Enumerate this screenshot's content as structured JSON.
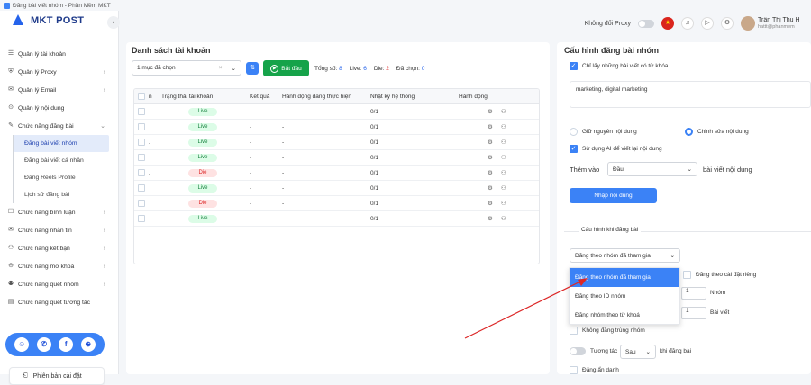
{
  "window": {
    "title": "Đăng bài viết nhóm - Phần Mềm MKT"
  },
  "sidebar": {
    "logo": "MKT POST",
    "collapse_glyph": "‹",
    "items": [
      {
        "label": "Quản lý tài khoản",
        "icon": "list-icon",
        "glyph": "☰",
        "chevron": ""
      },
      {
        "label": "Quản lý Proxy",
        "icon": "shield-icon",
        "glyph": "⛨",
        "chevron": "›"
      },
      {
        "label": "Quản lý Email",
        "icon": "mail-icon",
        "glyph": "✉",
        "chevron": "›"
      },
      {
        "label": "Quản lý nội dung",
        "icon": "content-icon",
        "glyph": "⊙",
        "chevron": ""
      },
      {
        "label": "Chức năng đăng bài",
        "icon": "post-icon",
        "glyph": "✎",
        "chevron": "⌄"
      }
    ],
    "sub_items": [
      {
        "label": "Đăng bài viết nhóm",
        "active": true
      },
      {
        "label": "Đăng bài viết cá nhân",
        "active": false
      },
      {
        "label": "Đăng Reels Profile",
        "active": false
      },
      {
        "label": "Lịch sử đăng bài",
        "active": false
      }
    ],
    "items_after": [
      {
        "label": "Chức năng bình luận",
        "icon": "comment-icon",
        "glyph": "☐",
        "chevron": "›"
      },
      {
        "label": "Chức năng nhắn tin",
        "icon": "message-icon",
        "glyph": "✉",
        "chevron": "›"
      },
      {
        "label": "Chức năng kết bạn",
        "icon": "add-friend-icon",
        "glyph": "⚇",
        "chevron": "›"
      },
      {
        "label": "Chức năng mở khoá",
        "icon": "unlock-icon",
        "glyph": "⊖",
        "chevron": "›"
      },
      {
        "label": "Chức năng quét nhóm",
        "icon": "group-icon",
        "glyph": "⚉",
        "chevron": "›"
      },
      {
        "label": "Chức năng quét tương tác",
        "icon": "interaction-icon",
        "glyph": "▤",
        "chevron": ""
      }
    ],
    "social": [
      {
        "name": "support-icon",
        "glyph": "☺"
      },
      {
        "name": "messenger-icon",
        "glyph": "✆"
      },
      {
        "name": "facebook-icon",
        "glyph": "f"
      },
      {
        "name": "globe-icon",
        "glyph": "⊕"
      }
    ],
    "version_label": "Phiên bản cài đặt",
    "version_glyph": "⎗"
  },
  "topbar": {
    "proxy_label": "Không đổi Proxy",
    "flag_glyph": "★",
    "bell_glyph": "♫",
    "play_glyph": "▷",
    "gear_glyph": "⚙",
    "user_name": "Trần Thị Thu H",
    "user_email": "hattt@phanmem"
  },
  "accounts": {
    "title": "Danh sách tài khoản",
    "select_value": "1 mục đã chọn",
    "clear_glyph": "×",
    "dropdown_glyph": "⌄",
    "filter_glyph": "⇅",
    "start_label": "Bắt đầu",
    "start_glyph": "▶",
    "stats": {
      "total_label": "Tổng số:",
      "total": "8",
      "live_label": "Live:",
      "live": "6",
      "die_label": "Die:",
      "die": "2",
      "selected_label": "Đã chọn:",
      "selected": "0"
    },
    "columns": [
      "n",
      "Trạng thái tài khoản",
      "Kết quả",
      "Hành động đang thực hiện",
      "Nhật ký hệ thống",
      "Hành động"
    ],
    "rows": [
      {
        "n": "",
        "status": "Live",
        "result": "-",
        "action": "-",
        "log": "0/1"
      },
      {
        "n": "",
        "status": "Live",
        "result": "-",
        "action": "-",
        "log": "0/1"
      },
      {
        "n": ".",
        "status": "Live",
        "result": "-",
        "action": "-",
        "log": "0/1"
      },
      {
        "n": "",
        "status": "Live",
        "result": "-",
        "action": "-",
        "log": "0/1"
      },
      {
        "n": ".",
        "status": "Die",
        "result": "-",
        "action": "-",
        "log": "0/1"
      },
      {
        "n": "",
        "status": "Live",
        "result": "-",
        "action": "-",
        "log": "0/1"
      },
      {
        "n": "",
        "status": "Die",
        "result": "-",
        "action": "-",
        "log": "0/1"
      },
      {
        "n": "",
        "status": "Live",
        "result": "-",
        "action": "-",
        "log": "0/1"
      }
    ],
    "row_action_glyphs": [
      "⚙",
      "⚇"
    ]
  },
  "config": {
    "title": "Cấu hình đăng bài nhóm",
    "keyword_only_label": "Chỉ lấy những bài viết có từ khóa",
    "keywords": "marketing, digital marketing",
    "keep_content_label": "Giữ nguyên nội dung",
    "edit_content_label": "Chỉnh sửa nội dung",
    "ai_rewrite_label": "Sử dụng AI để viết lại nội dung",
    "add_to_label": "Thêm vào",
    "add_to_value": "Đầu",
    "add_to_suffix": "bài viết nội dung",
    "enter_content_button": "Nhập nội dung",
    "posting_section_label": "Cấu hình khi đăng bài",
    "post_mode_value": "Đăng theo nhóm đã tham gia",
    "post_mode_options": [
      "Đăng theo nhóm đã tham gia",
      "Đăng theo ID nhóm",
      "Đăng nhóm theo từ khoá"
    ],
    "schedule_label": "Đăng theo cài đặt riêng",
    "group_unit": "Nhóm",
    "post_unit": "Bài viết",
    "group_count": "1",
    "post_count": "1",
    "no_duplicate_label": "Không đăng trùng nhóm",
    "interact_label": "Tương tác",
    "interact_value": "Sau",
    "interact_suffix": "khi đăng bài",
    "anonymous_label": "Đăng ẩn danh",
    "check_glyph": "✓"
  },
  "colors": {
    "accent": "#3b82f6",
    "live": "#15803d",
    "die": "#dc2626",
    "start": "#16a34a",
    "annotation_arrow": "#dc2626"
  }
}
